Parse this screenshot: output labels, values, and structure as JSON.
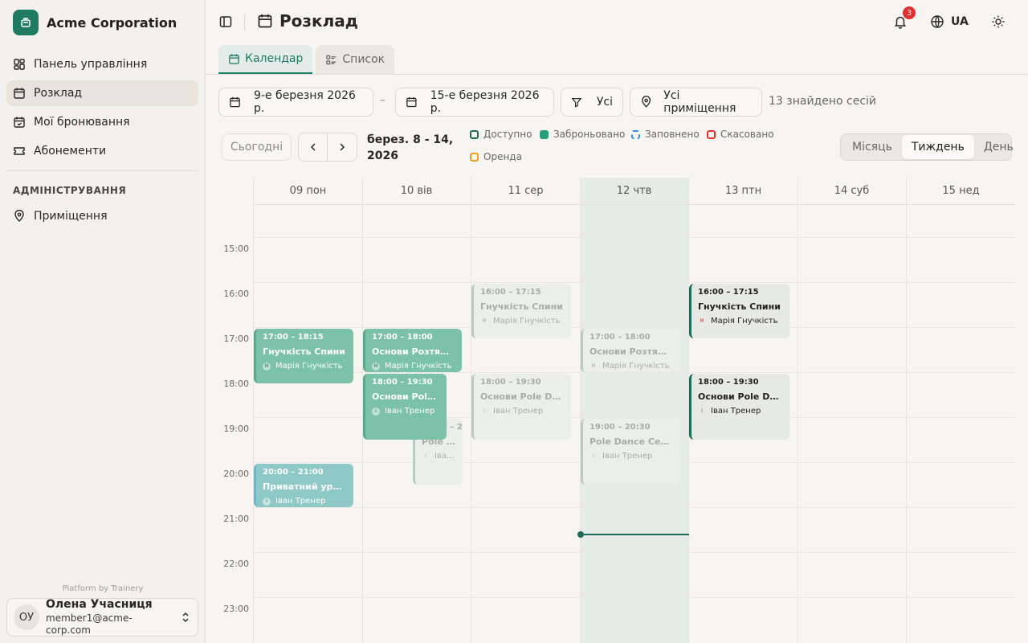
{
  "brand": {
    "name": "Acme Corporation"
  },
  "nav": {
    "items": [
      {
        "label": "Панель управління"
      },
      {
        "label": "Розклад"
      },
      {
        "label": "Мої бронювання"
      },
      {
        "label": "Абонементи"
      }
    ],
    "admin_label": "АДМІНІСТРУВАННЯ",
    "admin_items": [
      {
        "label": "Приміщення"
      }
    ]
  },
  "footer": {
    "platform": "Platform by Trainery"
  },
  "user": {
    "initials": "ОУ",
    "name": "Олена Учасниця",
    "email": "member1@acme-corp.com"
  },
  "header": {
    "title": "Розклад",
    "notifications": "3",
    "lang": "UA"
  },
  "tabs": [
    {
      "label": "Календар"
    },
    {
      "label": "Список"
    }
  ],
  "filters": {
    "date_from": "9-е березня 2026 р.",
    "date_to": "15-е березня 2026 р.",
    "type": "Усі",
    "room": "Усі приміщення",
    "found": "13 знайдено сесій"
  },
  "toolbar": {
    "today": "Сьогодні",
    "range": "берез. 8 - 14, 2026",
    "views": [
      {
        "label": "Місяць"
      },
      {
        "label": "Тиждень"
      },
      {
        "label": "День"
      }
    ]
  },
  "legend": [
    {
      "label": "Доступно",
      "color": "#1f6b57"
    },
    {
      "label": "Заброньовано",
      "color": "#2a9d7a"
    },
    {
      "label": "Заповнено",
      "color": "#3b8fd9"
    },
    {
      "label": "Скасовано",
      "color": "#e03131"
    },
    {
      "label": "Оренда",
      "color": "#f0a020"
    }
  ],
  "calendar": {
    "days": [
      {
        "label": "09 пон"
      },
      {
        "label": "10 вів"
      },
      {
        "label": "11 сер"
      },
      {
        "label": "12 чтв"
      },
      {
        "label": "13 птн"
      },
      {
        "label": "14 суб"
      },
      {
        "label": "15 нед"
      }
    ],
    "hours": [
      "15:00",
      "16:00",
      "17:00",
      "18:00",
      "19:00",
      "20:00",
      "21:00",
      "22:00",
      "23:00"
    ],
    "events": [
      {
        "time": "17:00 – 18:15",
        "name": "Гнучкість Спини",
        "initial": "M",
        "instructor": "Марія Гнучкість"
      },
      {
        "time": "20:00 – 21:00",
        "name": "Приватний урок ...",
        "initial": "І",
        "instructor": "Іван Тренер"
      },
      {
        "time": "17:00 – 18:00",
        "name": "Основи Розтяжки",
        "initial": "M",
        "instructor": "Марія Гнучкість"
      },
      {
        "time": "18:00 – 19:30",
        "name": "Основи Pole ...",
        "initial": "І",
        "instructor": "Іван Тренер"
      },
      {
        "time": "19:00 – 20",
        "name": "Pole ...",
        "initial": "І",
        "instructor": "Іва..."
      },
      {
        "time": "16:00 – 17:15",
        "name": "Гнучкість Спини",
        "initial": "M",
        "instructor": "Марія Гнучкість"
      },
      {
        "time": "18:00 – 19:30",
        "name": "Основи Pole Dan...",
        "initial": "І",
        "instructor": "Іван Тренер"
      },
      {
        "time": "17:00 – 18:00",
        "name": "Основи Розтяжки",
        "initial": "M",
        "instructor": "Марія Гнучкість"
      },
      {
        "time": "19:00 – 20:30",
        "name": "Pole Dance Сере...",
        "initial": "І",
        "instructor": "Іван Тренер"
      },
      {
        "time": "16:00 – 17:15",
        "name": "Гнучкість Спини",
        "initial": "M",
        "instructor": "Марія Гнучкість"
      },
      {
        "time": "18:00 – 19:30",
        "name": "Основи Pole Dan...",
        "initial": "І",
        "instructor": "Іван Тренер"
      }
    ]
  }
}
